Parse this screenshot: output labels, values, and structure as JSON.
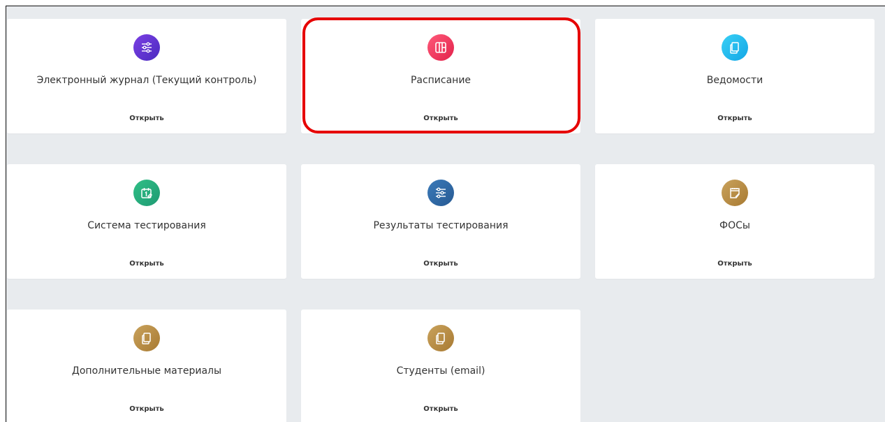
{
  "accent_highlight_color": "#e60000",
  "cards": [
    {
      "title": "Электронный журнал (Текущий контроль)",
      "action": "Открыть",
      "icon": "sliders-icon",
      "color": "purple"
    },
    {
      "title": "Расписание",
      "action": "Открыть",
      "icon": "layout-columns-icon",
      "color": "red"
    },
    {
      "title": "Ведомости",
      "action": "Открыть",
      "icon": "copy-icon",
      "color": "cyan"
    },
    {
      "title": "Система тестирования",
      "action": "Открыть",
      "icon": "calendar-icon",
      "color": "green"
    },
    {
      "title": "Результаты тестирования",
      "action": "Открыть",
      "icon": "sliders-icon",
      "color": "blue"
    },
    {
      "title": "ФОСы",
      "action": "Открыть",
      "icon": "notepad-icon",
      "color": "gold"
    },
    {
      "title": "Дополнительные материалы",
      "action": "Открыть",
      "icon": "copy-icon",
      "color": "gold"
    },
    {
      "title": "Студенты (email)",
      "action": "Открыть",
      "icon": "copy-icon",
      "color": "gold"
    }
  ]
}
